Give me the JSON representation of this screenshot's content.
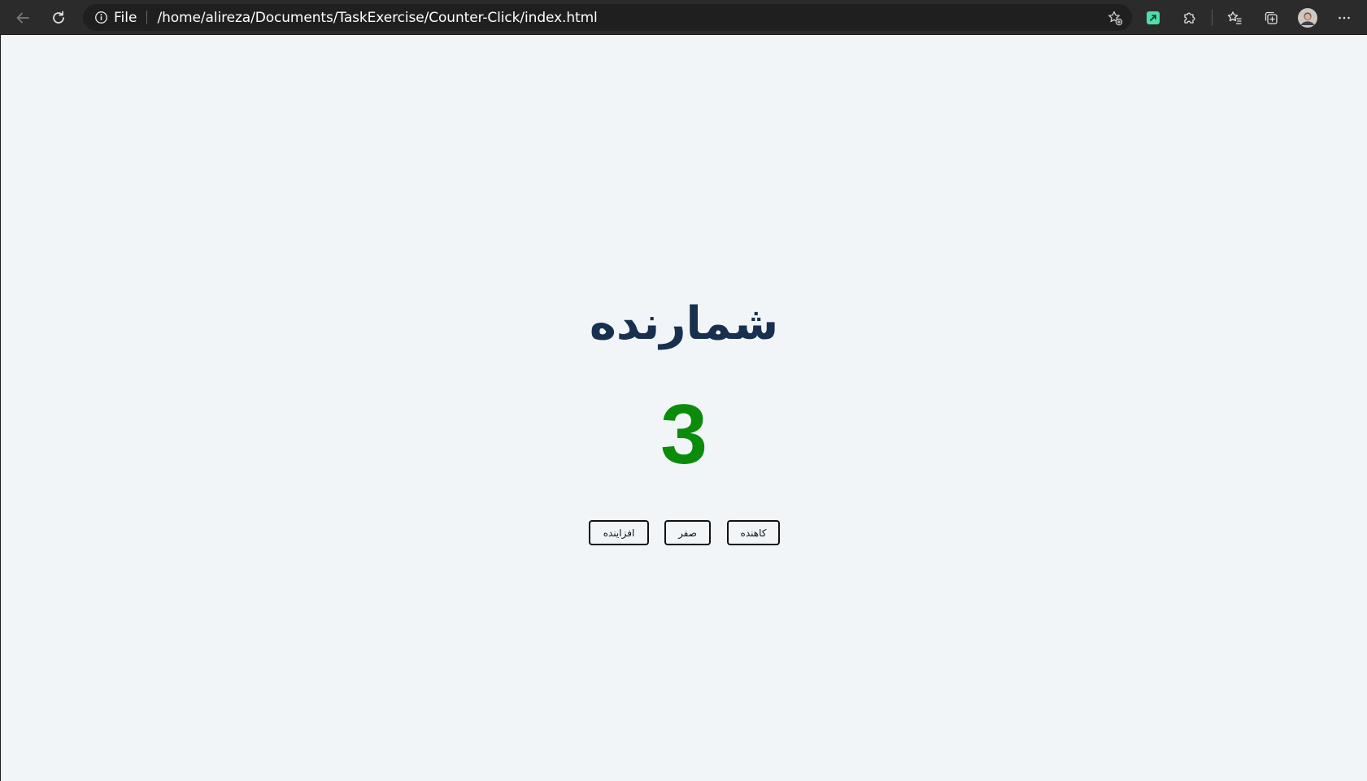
{
  "browser": {
    "scheme_label": "File",
    "url": "/home/alireza/Documents/TaskExercise/Counter-Click/index.html"
  },
  "page": {
    "title": "شمارنده",
    "count": "3",
    "buttons": {
      "increment": "افزاینده",
      "reset": "صفر",
      "decrement": "کاهنده"
    }
  },
  "colors": {
    "title": "#17304f",
    "count": "#0a8c0a",
    "background": "#f2f5f8"
  }
}
